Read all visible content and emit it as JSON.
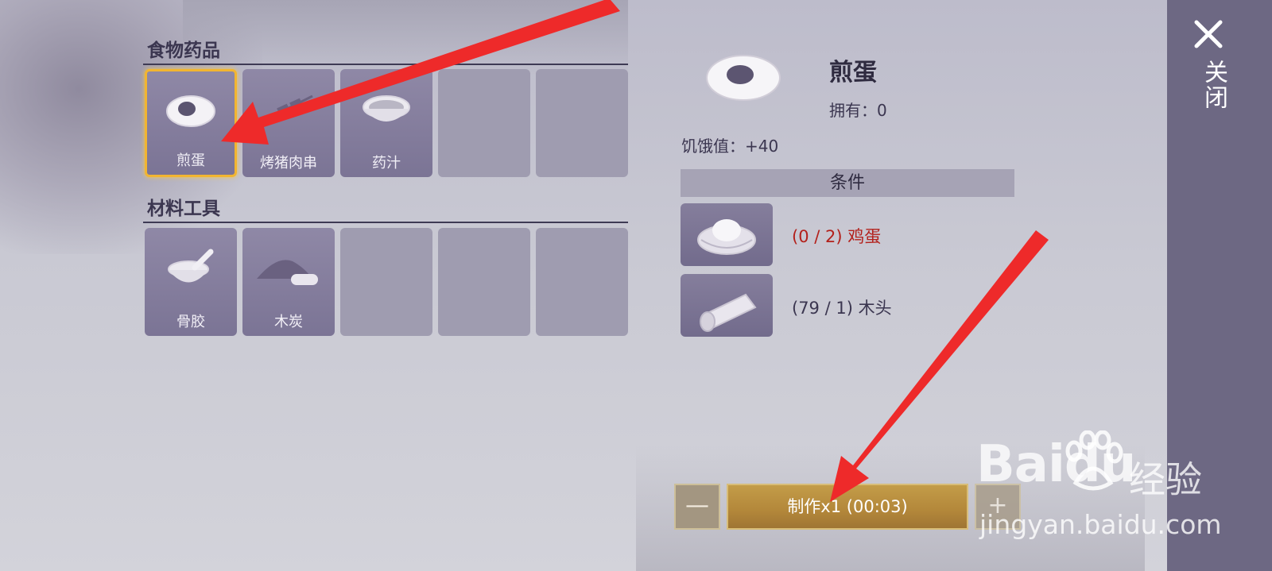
{
  "categories": {
    "food": {
      "title": "食物药品",
      "items": [
        {
          "label": "煎蛋",
          "icon": "fried-egg-icon",
          "selected": true
        },
        {
          "label": "烤猪肉串",
          "icon": "pork-skewer-icon"
        },
        {
          "label": "药汁",
          "icon": "medicine-bowl-icon"
        },
        {
          "label": ""
        },
        {
          "label": ""
        }
      ]
    },
    "materials": {
      "title": "材料工具",
      "items": [
        {
          "label": "骨胶",
          "icon": "bone-glue-icon"
        },
        {
          "label": "木炭",
          "icon": "charcoal-icon"
        },
        {
          "label": ""
        },
        {
          "label": ""
        },
        {
          "label": ""
        }
      ]
    }
  },
  "detail": {
    "name": "煎蛋",
    "owned": "拥有：0",
    "hunger": "饥饿值：+40",
    "conditions_title": "条件",
    "requirements": [
      {
        "text": "(0 / 2) 鸡蛋",
        "icon": "egg-nest-icon",
        "color": "#b3201b"
      },
      {
        "text": "(79 / 1) 木头",
        "icon": "wood-log-icon",
        "color": "#3b3650"
      }
    ]
  },
  "craft": {
    "minus": "—",
    "button": "制作x1 (00:03)",
    "plus": "+"
  },
  "close": {
    "label": "关闭"
  },
  "watermark": {
    "brand": "Baidu",
    "brand_cn": "经验",
    "url": "jingyan.baidu.com"
  },
  "colors": {
    "selected_border": "#f2b531",
    "missing_requirement": "#b3201b",
    "arrow": "#ee2a2a"
  }
}
